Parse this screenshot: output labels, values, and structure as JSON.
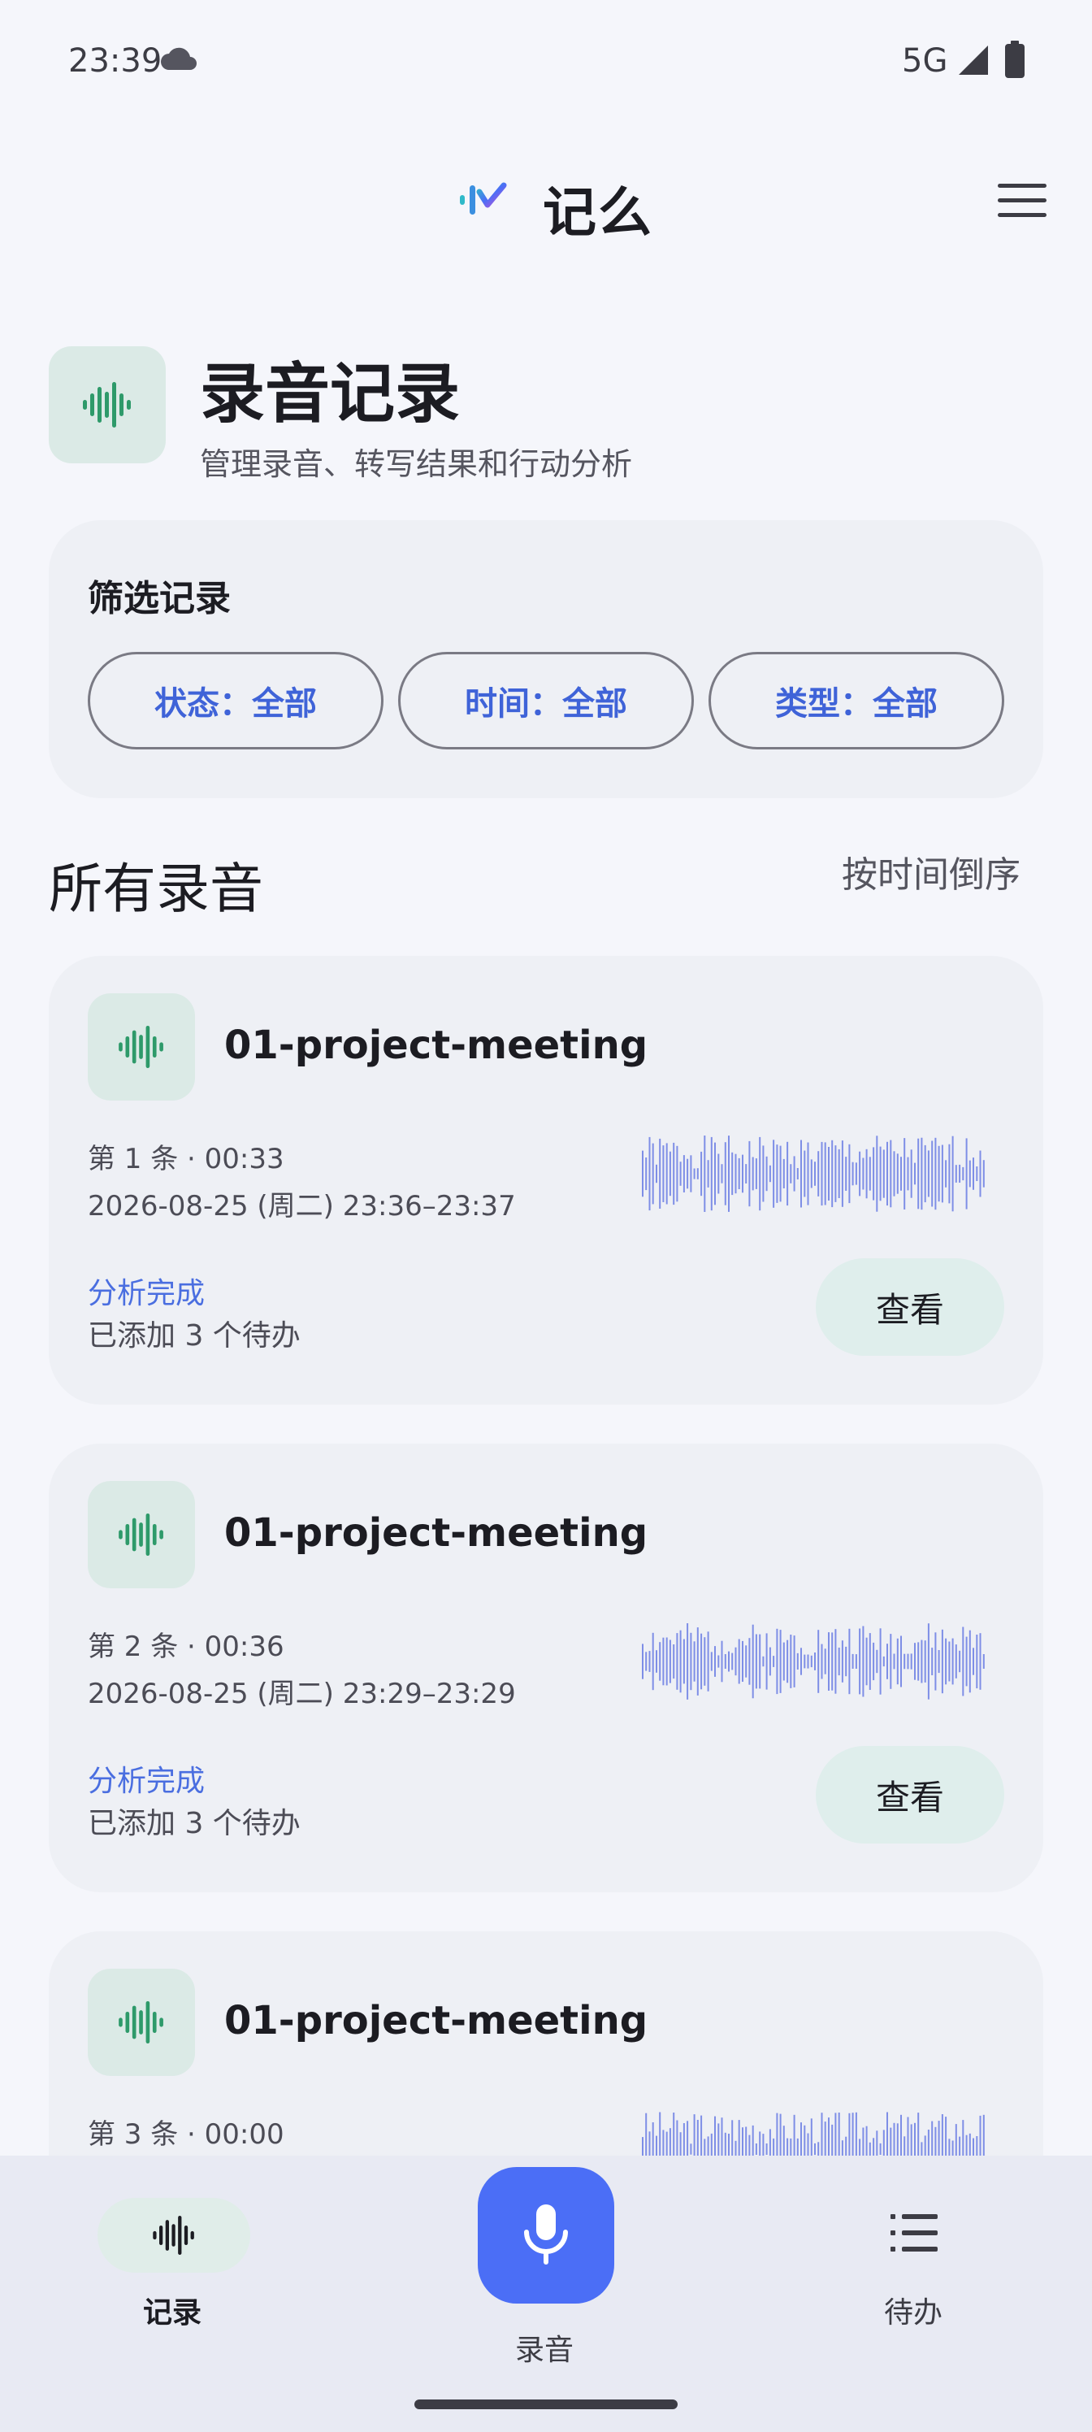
{
  "status_bar": {
    "time": "23:39",
    "network": "5G"
  },
  "app": {
    "title": "记么"
  },
  "page": {
    "title": "录音记录",
    "subtitle": "管理录音、转写结果和行动分析"
  },
  "filter": {
    "title": "筛选记录",
    "chips": [
      {
        "label": "状态：全部"
      },
      {
        "label": "时间：全部"
      },
      {
        "label": "类型：全部"
      }
    ]
  },
  "list": {
    "title": "所有录音",
    "sort_label": "按时间倒序",
    "items": [
      {
        "title": "01-project-meeting",
        "index_duration": "第 1 条 · 00:33",
        "datetime": "2026-08-25 (周二) 23:36–23:37",
        "status": "分析完成",
        "todo": "已添加 3 个待办",
        "button": "查看"
      },
      {
        "title": "01-project-meeting",
        "index_duration": "第 2 条 · 00:36",
        "datetime": "2026-08-25 (周二) 23:29–23:29",
        "status": "分析完成",
        "todo": "已添加 3 个待办",
        "button": "查看"
      },
      {
        "title": "01-project-meeting",
        "index_duration": "第 3 条 · 00:00"
      }
    ]
  },
  "bottom_nav": {
    "records": "记录",
    "record": "录音",
    "todos": "待办"
  },
  "colors": {
    "accent": "#4b6ef6",
    "status": "#4a6ee0",
    "icon_green": "#2e9a6a",
    "wave": "#7e8ee6"
  },
  "icons": [
    "cloud-icon",
    "signal-icon",
    "battery-icon",
    "menu-icon",
    "waveform-icon",
    "microphone-icon",
    "list-icon"
  ]
}
